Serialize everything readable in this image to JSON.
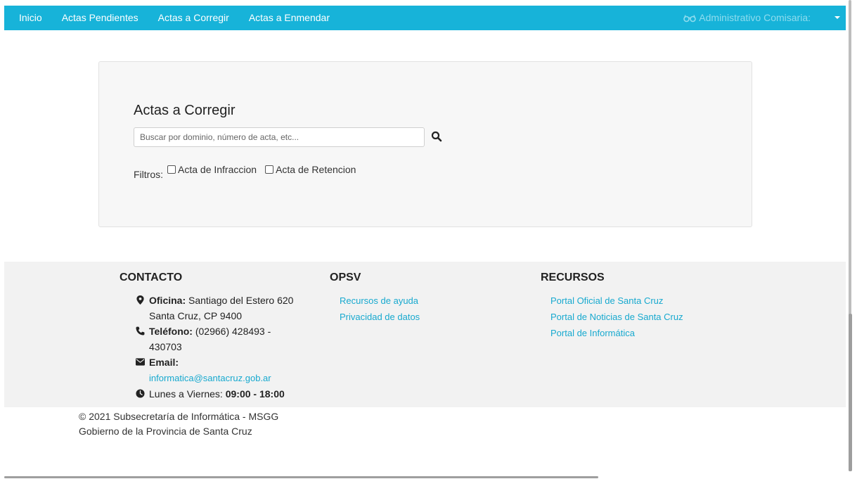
{
  "navbar": {
    "items": [
      {
        "label": "Inicio"
      },
      {
        "label": "Actas Pendientes"
      },
      {
        "label": "Actas a Corregir"
      },
      {
        "label": "Actas a Enmendar"
      }
    ],
    "user_label": "Administrativo Comisaria:",
    "user_icon": "glasses-icon",
    "color": "#17b3d9"
  },
  "main": {
    "title": "Actas a Corregir",
    "search_placeholder": "Buscar por dominio, número de acta, etc...",
    "filters_label": "Filtros:",
    "filters": [
      {
        "label": "Acta de Infraccion",
        "checked": false
      },
      {
        "label": "Acta de Retencion",
        "checked": false
      }
    ]
  },
  "footer": {
    "contact": {
      "heading": "CONTACTO",
      "office_label": "Oficina:",
      "office_line1": "Santiago del Estero 620",
      "office_line2": "Santa Cruz, CP 9400",
      "phone_label": "Teléfono:",
      "phone_line1": "(02966) 428493 -",
      "phone_line2": "430703",
      "email_label": "Email:",
      "email": "informatica@santacruz.gob.ar",
      "hours_prefix": "Lunes a Viernes:",
      "hours": "09:00 - 18:00"
    },
    "opsv": {
      "heading": "OPSV",
      "links": [
        "Recursos de ayuda",
        "Privacidad de datos"
      ]
    },
    "recursos": {
      "heading": "RECURSOS",
      "links": [
        "Portal Oficial de Santa Cruz",
        "Portal de Noticias de Santa Cruz",
        "Portal de Informática"
      ]
    },
    "link_color": "#17a9cf"
  },
  "copyright": {
    "line1": "© 2021 Subsecretaría de Informática - MSGG",
    "line2": "Gobierno de la Provincia de Santa Cruz"
  }
}
